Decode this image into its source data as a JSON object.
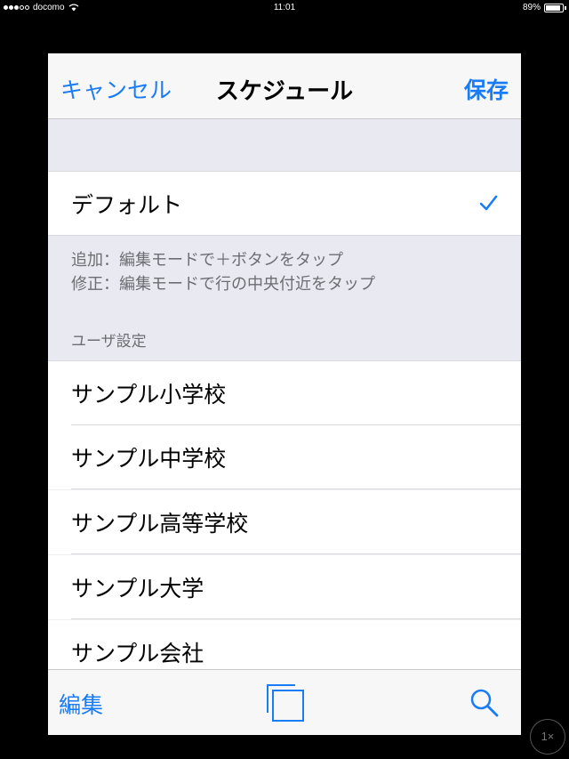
{
  "status": {
    "carrier": "docomo",
    "time": "11:01",
    "battery": "89%",
    "battery_level": 0.89
  },
  "nav": {
    "cancel": "キャンセル",
    "title": "スケジュール",
    "save": "保存"
  },
  "default_section": {
    "item": "デフォルト",
    "footnote_line1": "追加：編集モードで＋ボタンをタップ",
    "footnote_line2": "修正：編集モードで行の中央付近をタップ"
  },
  "user_section": {
    "header": "ユーザ設定",
    "items": [
      {
        "label": "サンプル小学校"
      },
      {
        "label": "サンプル中学校"
      },
      {
        "label": "サンプル高等学校"
      },
      {
        "label": "サンプル大学"
      },
      {
        "label": "サンプル会社"
      }
    ]
  },
  "toolbar": {
    "edit": "編集",
    "copy_icon": "copy-icon",
    "search_icon": "search-icon"
  },
  "zoom": "1×",
  "colors": {
    "tint": "#1a7cf5",
    "background": "#efeff4"
  }
}
